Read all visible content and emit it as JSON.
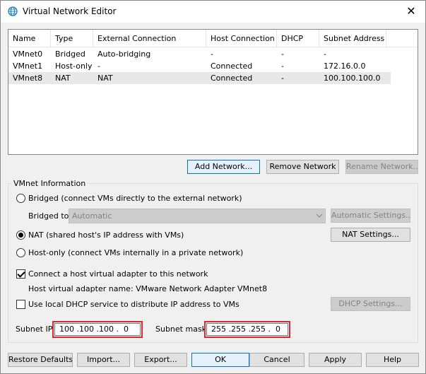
{
  "window": {
    "title": "Virtual Network Editor",
    "close_glyph": "✕"
  },
  "table": {
    "headers": [
      "Name",
      "Type",
      "External Connection",
      "Host Connection",
      "DHCP",
      "Subnet Address"
    ],
    "rows": [
      [
        "VMnet0",
        "Bridged",
        "Auto-bridging",
        "-",
        "-",
        "-"
      ],
      [
        "VMnet1",
        "Host-only",
        "-",
        "Connected",
        "-",
        "172.16.0.0"
      ],
      [
        "VMnet8",
        "NAT",
        "NAT",
        "Connected",
        "-",
        "100.100.100.0"
      ]
    ],
    "selected_row": 2
  },
  "network_buttons": {
    "add": "Add Network...",
    "remove": "Remove Network",
    "rename": "Rename Network..."
  },
  "vmnet_info": {
    "legend": "VMnet Information",
    "bridged_label": "Bridged (connect VMs directly to the external network)",
    "bridged_to_label": "Bridged to:",
    "bridged_to_value": "Automatic",
    "automatic_settings": "Automatic Settings...",
    "nat_label": "NAT (shared host's IP address with VMs)",
    "nat_settings": "NAT Settings...",
    "hostonly_label": "Host-only (connect VMs internally in a private network)",
    "selected_mode": "nat",
    "connect_adapter_label": "Connect a host virtual adapter to this network",
    "connect_adapter_checked": true,
    "adapter_name_label": "Host virtual adapter name: VMware Network Adapter VMnet8",
    "dhcp_label": "Use local DHCP service to distribute IP address to VMs",
    "dhcp_checked": false,
    "dhcp_settings": "DHCP Settings...",
    "subnet_ip_label": "Subnet IP:",
    "subnet_ip_value": "100 .100 .100 .  0",
    "subnet_mask_label": "Subnet mask:",
    "subnet_mask_value": "255 .255 .255 .  0"
  },
  "bottom_buttons": {
    "restore": "Restore Defaults",
    "import": "Import...",
    "export": "Export...",
    "ok": "OK",
    "cancel": "Cancel",
    "apply": "Apply",
    "help": "Help"
  },
  "colors": {
    "highlight": "#d9262f",
    "focus_border": "#0078d7"
  }
}
